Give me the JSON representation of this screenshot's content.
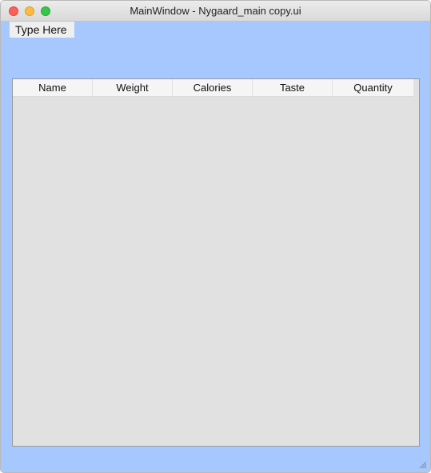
{
  "window": {
    "title": "MainWindow - Nygaard_main copy.ui",
    "background_color": "#a6c8ff",
    "controls": [
      "close-icon",
      "minimize-icon",
      "maximize-icon"
    ]
  },
  "menubar": {
    "placeholder_item": "Type Here"
  },
  "table": {
    "columns": [
      "Name",
      "Weight",
      "Calories",
      "Taste",
      "Quantity"
    ],
    "rows": []
  },
  "resize_grip": {
    "icon": "resize-grip-icon"
  }
}
